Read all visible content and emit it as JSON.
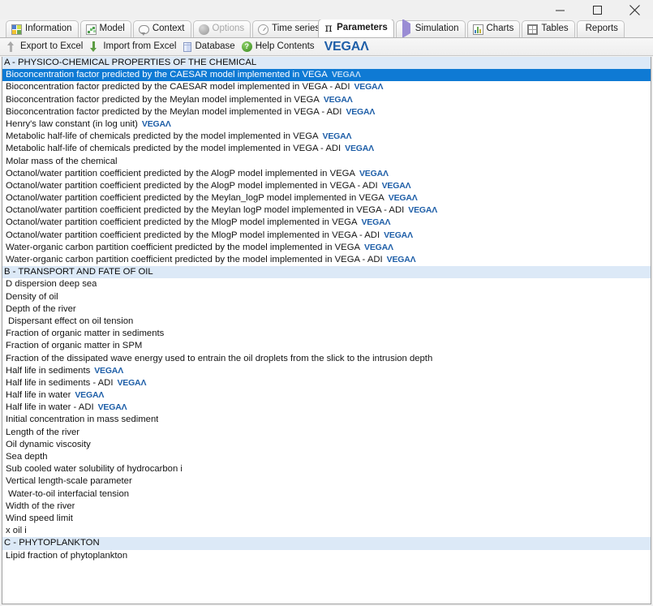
{
  "window": {
    "controls": {
      "minimize": "minimize-button",
      "maximize": "maximize-button",
      "close": "close-button"
    }
  },
  "tabs": [
    {
      "label": "Information",
      "icon": "information-icon",
      "active": false,
      "disabled": false
    },
    {
      "label": "Model",
      "icon": "model-scatter-icon",
      "active": false,
      "disabled": false
    },
    {
      "label": "Context",
      "icon": "speech-bubble-icon",
      "active": false,
      "disabled": false
    },
    {
      "label": "Options",
      "icon": "sphere-icon",
      "active": false,
      "disabled": true
    },
    {
      "label": "Time series",
      "icon": "clock-icon",
      "active": false,
      "disabled": false
    },
    {
      "label": "Parameters",
      "icon": "pi-icon",
      "active": true,
      "disabled": false
    },
    {
      "label": "Simulation",
      "icon": "play-icon",
      "active": false,
      "disabled": false
    },
    {
      "label": "Charts",
      "icon": "bar-chart-icon",
      "active": false,
      "disabled": false
    },
    {
      "label": "Tables",
      "icon": "table-grid-icon",
      "active": false,
      "disabled": false
    },
    {
      "label": "Reports",
      "icon": "none",
      "active": false,
      "disabled": false
    }
  ],
  "toolbar": {
    "export_label": "Export to Excel",
    "import_label": "Import from Excel",
    "database_label": "Database",
    "help_label": "Help Contents",
    "help_glyph": "?",
    "brand": "VEGA",
    "brand_lambda": "Λ"
  },
  "colors": {
    "selection": "#0f7ad4",
    "section_header": "#dce9f7",
    "vega_blue": "#1f5fa8",
    "text": "#141414",
    "window_chrome": "#f0f0f0"
  },
  "list": {
    "rows": [
      {
        "label": "A - PHYSICO-CHEMICAL PROPERTIES OF THE CHEMICAL",
        "type": "section"
      },
      {
        "label": "Bioconcentration factor predicted by the CAESAR model implemented in VEGA",
        "type": "item",
        "vega": true,
        "selected": true
      },
      {
        "label": "Bioconcentration factor predicted by the CAESAR model implemented in VEGA - ADI",
        "type": "item",
        "vega": true
      },
      {
        "label": "Bioconcentration factor predicted by the Meylan model implemented in VEGA",
        "type": "item",
        "vega": true
      },
      {
        "label": "Bioconcentration factor predicted by the Meylan model implemented in VEGA - ADI",
        "type": "item",
        "vega": true
      },
      {
        "label": "Henry's law constant (in log unit)",
        "type": "item",
        "vega": true
      },
      {
        "label": "Metabolic half-life of chemicals predicted by the model implemented in VEGA",
        "type": "item",
        "vega": true
      },
      {
        "label": "Metabolic half-life of chemicals predicted by the model implemented in VEGA - ADI",
        "type": "item",
        "vega": true
      },
      {
        "label": "Molar mass of the chemical",
        "type": "item",
        "vega": false
      },
      {
        "label": "Octanol/water partition coefficient predicted by the AlogP model implemented in VEGA",
        "type": "item",
        "vega": true
      },
      {
        "label": "Octanol/water partition coefficient predicted by the AlogP model implemented in VEGA - ADI",
        "type": "item",
        "vega": true
      },
      {
        "label": "Octanol/water partition coefficient predicted by the Meylan_logP model implemented in VEGA",
        "type": "item",
        "vega": true
      },
      {
        "label": "Octanol/water partition coefficient predicted by the Meylan logP model implemented in VEGA - ADI",
        "type": "item",
        "vega": true
      },
      {
        "label": "Octanol/water partition coefficient predicted by the MlogP model implemented in VEGA",
        "type": "item",
        "vega": true
      },
      {
        "label": "Octanol/water partition coefficient predicted by the MlogP model implemented in VEGA - ADI",
        "type": "item",
        "vega": true
      },
      {
        "label": "Water-organic carbon partition coefficient predicted by the model implemented in VEGA",
        "type": "item",
        "vega": true
      },
      {
        "label": "Water-organic carbon partition coefficient predicted by the model implemented in VEGA - ADI",
        "type": "item",
        "vega": true
      },
      {
        "label": "B - TRANSPORT AND FATE OF OIL",
        "type": "section"
      },
      {
        "label": "D dispersion deep sea",
        "type": "item",
        "vega": false
      },
      {
        "label": "Density of oil",
        "type": "item",
        "vega": false
      },
      {
        "label": "Depth of the river",
        "type": "item",
        "vega": false
      },
      {
        "label": "Dispersant effect on oil tension",
        "type": "item",
        "vega": false,
        "indent": true
      },
      {
        "label": "Fraction of organic matter in sediments",
        "type": "item",
        "vega": false
      },
      {
        "label": "Fraction of organic matter in SPM",
        "type": "item",
        "vega": false
      },
      {
        "label": "Fraction of the dissipated wave energy used to entrain the oil droplets from the slick to the intrusion depth",
        "type": "item",
        "vega": false
      },
      {
        "label": "Half life in sediments",
        "type": "item",
        "vega": true
      },
      {
        "label": "Half life in sediments - ADI",
        "type": "item",
        "vega": true
      },
      {
        "label": "Half life in water",
        "type": "item",
        "vega": true
      },
      {
        "label": "Half life in water - ADI",
        "type": "item",
        "vega": true
      },
      {
        "label": "Initial concentration in mass sediment",
        "type": "item",
        "vega": false
      },
      {
        "label": "Length of the river",
        "type": "item",
        "vega": false
      },
      {
        "label": "Oil dynamic viscosity",
        "type": "item",
        "vega": false
      },
      {
        "label": "Sea depth",
        "type": "item",
        "vega": false
      },
      {
        "label": "Sub cooled water solubility of hydrocarbon i",
        "type": "item",
        "vega": false
      },
      {
        "label": "Vertical length-scale parameter",
        "type": "item",
        "vega": false
      },
      {
        "label": "Water-to-oil interfacial tension",
        "type": "item",
        "vega": false,
        "indent": true
      },
      {
        "label": "Width of the river",
        "type": "item",
        "vega": false
      },
      {
        "label": "Wind speed limit",
        "type": "item",
        "vega": false
      },
      {
        "label": "x oil i",
        "type": "item",
        "vega": false
      },
      {
        "label": "C - PHYTOPLANKTON",
        "type": "section"
      },
      {
        "label": "Lipid fraction of phytoplankton",
        "type": "item",
        "vega": false
      }
    ]
  }
}
